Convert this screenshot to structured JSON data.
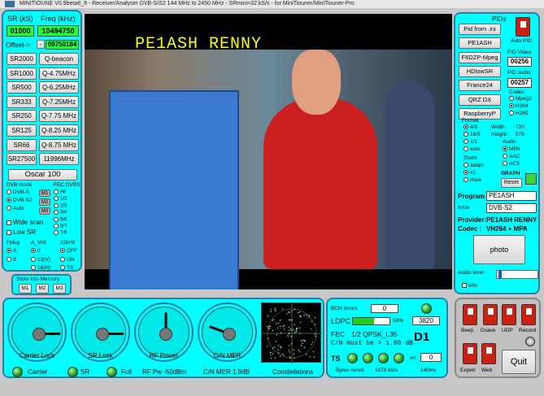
{
  "window": {
    "title": "MINITIOUNE V0.9beta8_9 - Receiver/Analyser DVB-S/S2 144 MHz to 2450 MHz - SRmini=32 kS/s - for MiniTiouner/MiniTiouner-Pro"
  },
  "left": {
    "sr_label": "SR (kS)",
    "freq_label": "Freq (kHz)",
    "sr_value": "01000",
    "freq_value": "10494750",
    "offset_label": "Offset->",
    "offset_arrow": "-",
    "offset_value": "09750184",
    "sr_buttons": [
      "SR2000",
      "SR1000",
      "SR500",
      "SR333",
      "SR250",
      "SR125",
      "SR66",
      "SR27500"
    ],
    "freq_buttons": [
      "Q-beacon",
      "Q-4.75MHz",
      "Q-6.25MHz",
      "Q-7.25MHz",
      "Q-7.75 MHz",
      "Q-8.25 MHz",
      "Q-8.75 MHz",
      "11996MHz"
    ],
    "oscar_button": "Oscar 100",
    "dvb_mode_label": "DVB mode",
    "dvb_modes": [
      "DVB-S",
      "DVB-S2",
      "Auto"
    ],
    "m_buttons": [
      "M1",
      "M2",
      "M3"
    ],
    "fec_label": "FEC DVBS",
    "fec_options": [
      "All",
      "1/2",
      "2/3",
      "3/4",
      "5/6",
      "6/7",
      "7/8"
    ],
    "wide_scan": "Wide scan",
    "low_sr": "Low SR",
    "fplug_label": "Fplug",
    "fplug_options": [
      "A",
      "B"
    ],
    "avolt_label": "A_Volt",
    "avolt_options": [
      "0",
      "13(V)",
      "18(H)"
    ],
    "khz_label": "22kHz",
    "khz_options": [
      "OFF",
      "ON",
      "TS"
    ],
    "store_label": "Store into Memory",
    "store_buttons": [
      "M1",
      "M2",
      "M3"
    ]
  },
  "video": {
    "overlay_text": "PE1ASH  RENNY"
  },
  "right": {
    "pids_label": "PIDs",
    "pid_buttons": [
      "Pid from .ini",
      "PE1ASH",
      "F6DZP-Mpeg",
      "HDlowSR",
      "France24",
      "QRZ DX",
      "RaspberryP"
    ],
    "auto_pid": "Auto PID",
    "pid_video_label": "PID Video",
    "pid_video": "00256",
    "pid_audio_label": "PID audio",
    "pid_audio": "00257",
    "codec_label": "Codec",
    "codec_options": [
      "Mpeg2",
      "H264",
      "H265"
    ],
    "format_label": "Format",
    "format_options": [
      "4/3",
      "16/9",
      "1/1",
      "auto"
    ],
    "width_label": "Width :",
    "width_value": "720",
    "height_label": "Height :",
    "height_value": "576",
    "audio_label": "Audio",
    "audio_options": [
      "MPA",
      "AAC",
      "AC3"
    ],
    "zoom_label": "Zoom",
    "zoom_options": [
      "adapt",
      "x1",
      "maxi"
    ],
    "graph_label": "GRAPH",
    "reset_button": "Reset",
    "program_label": "Program",
    "program_value": "PE1ASH",
    "infos_label": "Infos",
    "infos_value": "DVB-S2",
    "provider_label": "Provider:",
    "provider_value": "PE1ASH RENNY",
    "codec2_label": "Codec :",
    "codec2_value": "VH264 + MPA",
    "photo_button": "photo",
    "audio_level_label": "Audio level",
    "audio_level": 0.05,
    "info_label": "Info"
  },
  "gauges": [
    {
      "name": "carrier-lock-gauge",
      "label": "Carrier Lock",
      "angle": 0
    },
    {
      "name": "sr-lock-gauge",
      "label": "SR Lock",
      "angle": 0
    },
    {
      "name": "rf-power-gauge",
      "label": "RF Power",
      "angle": -90
    },
    {
      "name": "cn-mer-gauge",
      "label": "C/N MER",
      "angle": -160
    }
  ],
  "status": {
    "carrier": "Carrier",
    "sr": "SR",
    "full": "Full",
    "rf_pw": "RF Pw  -50dBm",
    "cn_mer": "C/N MER  1.9dB",
    "constellations": "Constellations"
  },
  "bch": {
    "bch_label": "BCH errors",
    "bch_value": "0",
    "ldpc_label": "LDPC",
    "ldpc_percent": "58%",
    "ldpc_level": 0.58,
    "ldpc_value": "3820",
    "fec_label": "FEC",
    "fec_value": "1/2 QPSK_L35",
    "cn_note": "C/N must be > 1.00 dB",
    "d_value": "D1",
    "ts_label": "TS",
    "err_label": "err",
    "err_value": "0",
    "bytes_label": "Bytes recvd:",
    "bytes_value": "1079 kb/s",
    "ms_value": "140ms"
  },
  "controls": {
    "beep": "Beep",
    "dsave": "Dsave",
    "udp": "UDP",
    "record": "Record",
    "expert": "Expert",
    "web": "Web",
    "quit": "Quit"
  },
  "colors": {
    "panel": "#00ffff",
    "value_green": "#1fff3a",
    "border": "#2a7fa8",
    "overlay": "#ffff00",
    "toggle_red": "#cc2010"
  }
}
